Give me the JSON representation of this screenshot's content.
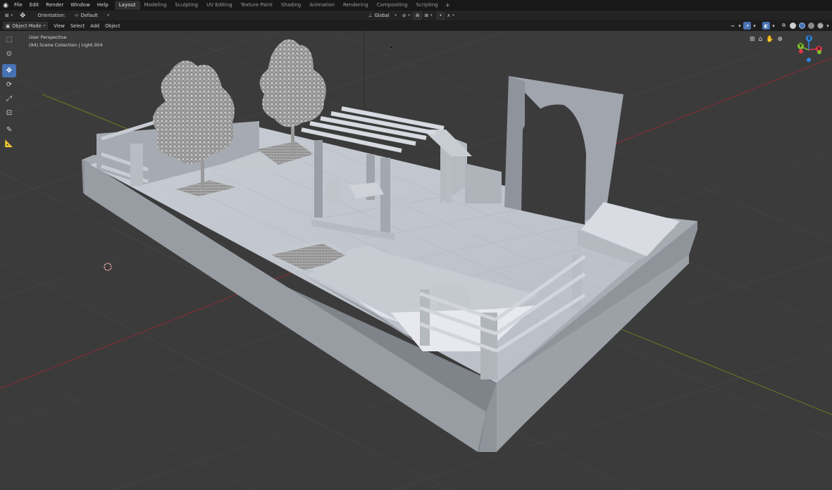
{
  "menu": [
    "File",
    "Edit",
    "Render",
    "Window",
    "Help"
  ],
  "workspaces": [
    "Layout",
    "Modeling",
    "Sculpting",
    "UV Editing",
    "Texture Paint",
    "Shading",
    "Animation",
    "Rendering",
    "Compositing",
    "Scripting"
  ],
  "active_workspace": "Layout",
  "add_workspace": "+",
  "header": {
    "orientation_label": "Orientation:",
    "orientation_value": "Default",
    "transform_space": "Global"
  },
  "mode": {
    "label": "Object Mode",
    "menus": [
      "View",
      "Select",
      "Add",
      "Object"
    ]
  },
  "viewport": {
    "perspective": "User Perspective",
    "collection_info": "(94) Scene Collection | Light.004"
  },
  "toolbar_tools": [
    "select-box-icon",
    "cursor-icon",
    "move-icon",
    "rotate-icon",
    "scale-icon",
    "transform-icon",
    "annotate-icon",
    "measure-icon"
  ],
  "gizmo_axes": {
    "x": "X",
    "y": "Y",
    "z": "Z"
  },
  "colors": {
    "accent": "#4772b3",
    "x_axis": "#e0364a",
    "y_axis": "#7cbd2c",
    "z_axis": "#2e86e0",
    "viewport_bg": "#3d3d3d"
  }
}
